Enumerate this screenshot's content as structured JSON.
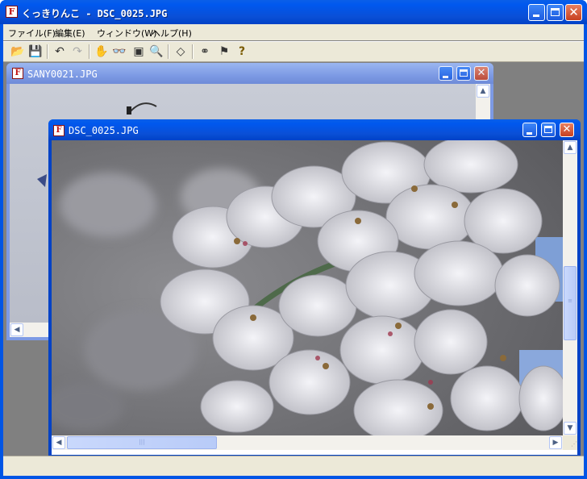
{
  "app": {
    "icon_letter": "F",
    "title": "くっきりんこ - DSC_0025.JPG"
  },
  "menu": [
    {
      "label": "ファイル(F)"
    },
    {
      "label": "編集(E)"
    },
    {
      "label": "ウィンドウ(W)"
    },
    {
      "label": "ヘルプ(H)"
    }
  ],
  "toolbar": {
    "buttons": [
      {
        "name": "open-icon",
        "glyph": "📂"
      },
      {
        "name": "save-icon",
        "glyph": "💾"
      },
      {
        "name": "undo-icon",
        "glyph": "↶"
      },
      {
        "name": "redo-icon",
        "glyph": "↷"
      },
      {
        "name": "hand-icon",
        "glyph": "✋"
      },
      {
        "name": "glasses-icon",
        "glyph": "👓"
      },
      {
        "name": "fit-window-icon",
        "glyph": "▣"
      },
      {
        "name": "zoom-icon",
        "glyph": "🔍"
      },
      {
        "name": "eraser-icon",
        "glyph": "◇"
      },
      {
        "name": "binoculars-icon",
        "glyph": "⚭"
      },
      {
        "name": "help-pointer-icon",
        "glyph": "⚑"
      },
      {
        "name": "help-icon",
        "glyph": "?"
      }
    ]
  },
  "windows": [
    {
      "id": "back",
      "icon_letter": "F",
      "title": "SANY0021.JPG",
      "state": "inactive"
    },
    {
      "id": "front",
      "icon_letter": "F",
      "title": "DSC_0025.JPG",
      "state": "active"
    }
  ],
  "photo": {
    "subject": "cherry-blossom",
    "colors": {
      "sky": "#7e9fd6",
      "petal": "#e8e8ee",
      "shadow": "#4a4a50",
      "stamen": "#8a6a3a"
    }
  },
  "status": {
    "text": ""
  }
}
